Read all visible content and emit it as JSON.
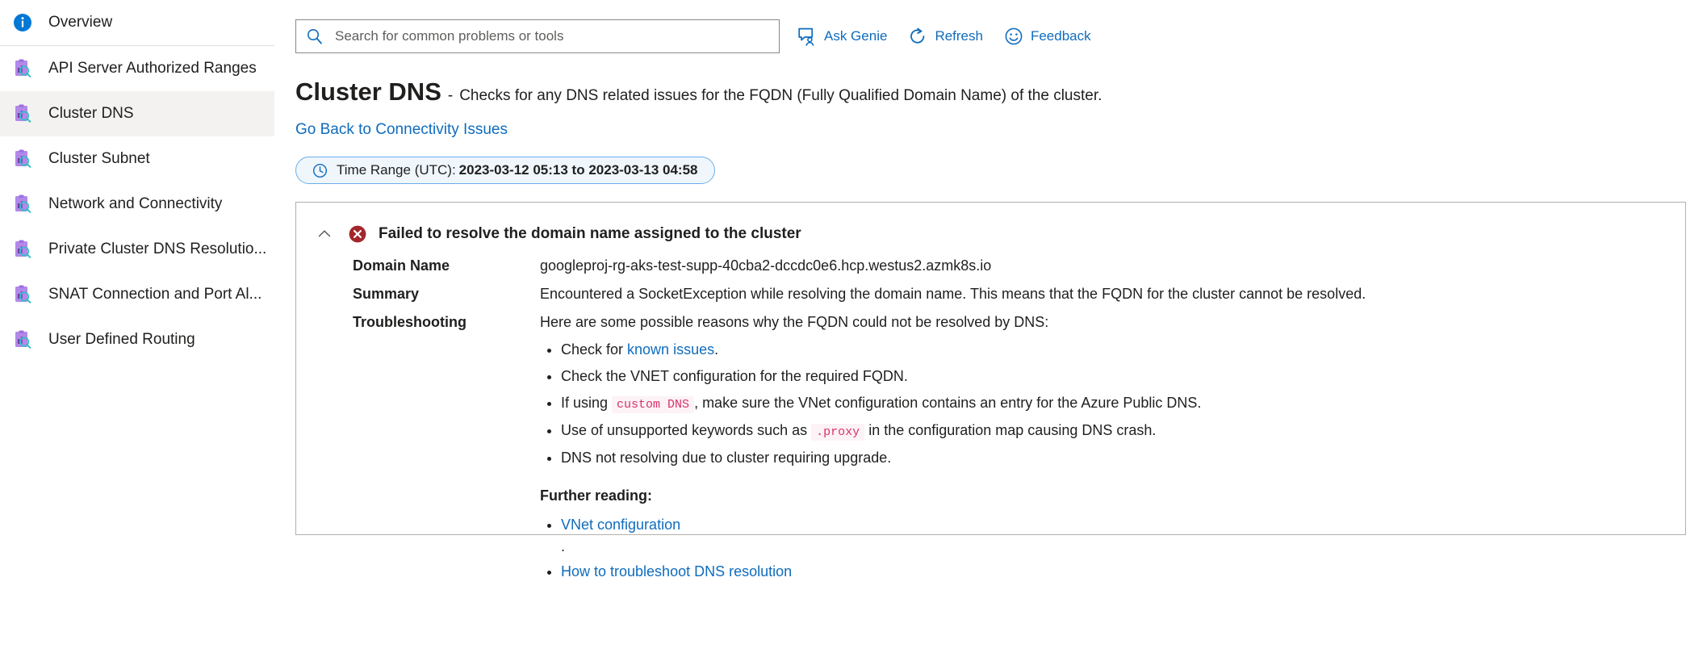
{
  "sidebar": {
    "items": [
      {
        "label": "Overview",
        "icon": "info-circle-icon",
        "selected": false
      },
      {
        "label": "API Server Authorized Ranges",
        "icon": "diagnostic-clipboard-icon",
        "selected": false
      },
      {
        "label": "Cluster DNS",
        "icon": "diagnostic-clipboard-icon",
        "selected": true
      },
      {
        "label": "Cluster Subnet",
        "icon": "diagnostic-clipboard-icon",
        "selected": false
      },
      {
        "label": "Network and Connectivity",
        "icon": "diagnostic-clipboard-icon",
        "selected": false
      },
      {
        "label": "Private Cluster DNS Resolutio...",
        "icon": "diagnostic-clipboard-icon",
        "selected": false
      },
      {
        "label": "SNAT Connection and Port Al...",
        "icon": "diagnostic-clipboard-icon",
        "selected": false
      },
      {
        "label": "User Defined Routing",
        "icon": "diagnostic-clipboard-icon",
        "selected": false
      }
    ]
  },
  "toolbar": {
    "search_placeholder": "Search for common problems or tools",
    "search_value": "",
    "search_icon": "search-icon",
    "buttons": [
      {
        "label": "Ask Genie",
        "icon": "ask-genie-icon"
      },
      {
        "label": "Refresh",
        "icon": "refresh-icon"
      },
      {
        "label": "Feedback",
        "icon": "feedback-smiley-icon"
      }
    ]
  },
  "header": {
    "title": "Cluster DNS",
    "dash": "-",
    "subtitle": "Checks for any DNS related issues for the FQDN (Fully Qualified Domain Name) of the cluster.",
    "back_link": "Go Back to Connectivity Issues"
  },
  "time_range": {
    "icon": "clock-icon",
    "label": "Time Range (UTC):",
    "value": "2023-03-12 05:13 to 2023-03-13 04:58"
  },
  "result": {
    "collapse_icon": "chevron-up-icon",
    "status_icon": "error-circle-icon",
    "status_color": "#a4262c",
    "title": "Failed to resolve the domain name assigned to the cluster",
    "rows": [
      {
        "label": "Domain Name",
        "value": "googleproj-rg-aks-test-supp-40cba2-dccdc0e6.hcp.westus2.azmk8s.io"
      },
      {
        "label": "Summary",
        "value": "Encountered a SocketException while resolving the domain name. This means that the FQDN for the cluster cannot be resolved."
      }
    ],
    "troubleshooting": {
      "label": "Troubleshooting",
      "intro": "Here are some possible reasons why the FQDN could not be resolved by DNS:",
      "bullets": [
        {
          "pre": "Check for ",
          "link": "known issues",
          "post": "."
        },
        {
          "pre": "Check the VNET configuration for the required FQDN.",
          "link": "",
          "post": ""
        },
        {
          "pre": "If using ",
          "code": "custom DNS",
          "post": ", make sure the VNet configuration contains an entry for the Azure Public DNS."
        },
        {
          "pre": "Use of unsupported keywords such as ",
          "code": ".proxy",
          "post": " in the configuration map causing DNS crash."
        },
        {
          "pre": "DNS not resolving due to cluster requiring upgrade.",
          "link": "",
          "post": ""
        }
      ],
      "further_reading_heading": "Further reading:",
      "further_reading": [
        {
          "text": "VNet configuration",
          "is_link": true
        },
        {
          "text": ".",
          "is_link": false
        },
        {
          "text": "How to troubleshoot DNS resolution",
          "is_link": true
        }
      ]
    }
  },
  "colors": {
    "accent_blue": "#0f6cbd",
    "error_red": "#a4262c",
    "code_pink": "#d6336c",
    "selected_bg": "#f3f2f1"
  }
}
